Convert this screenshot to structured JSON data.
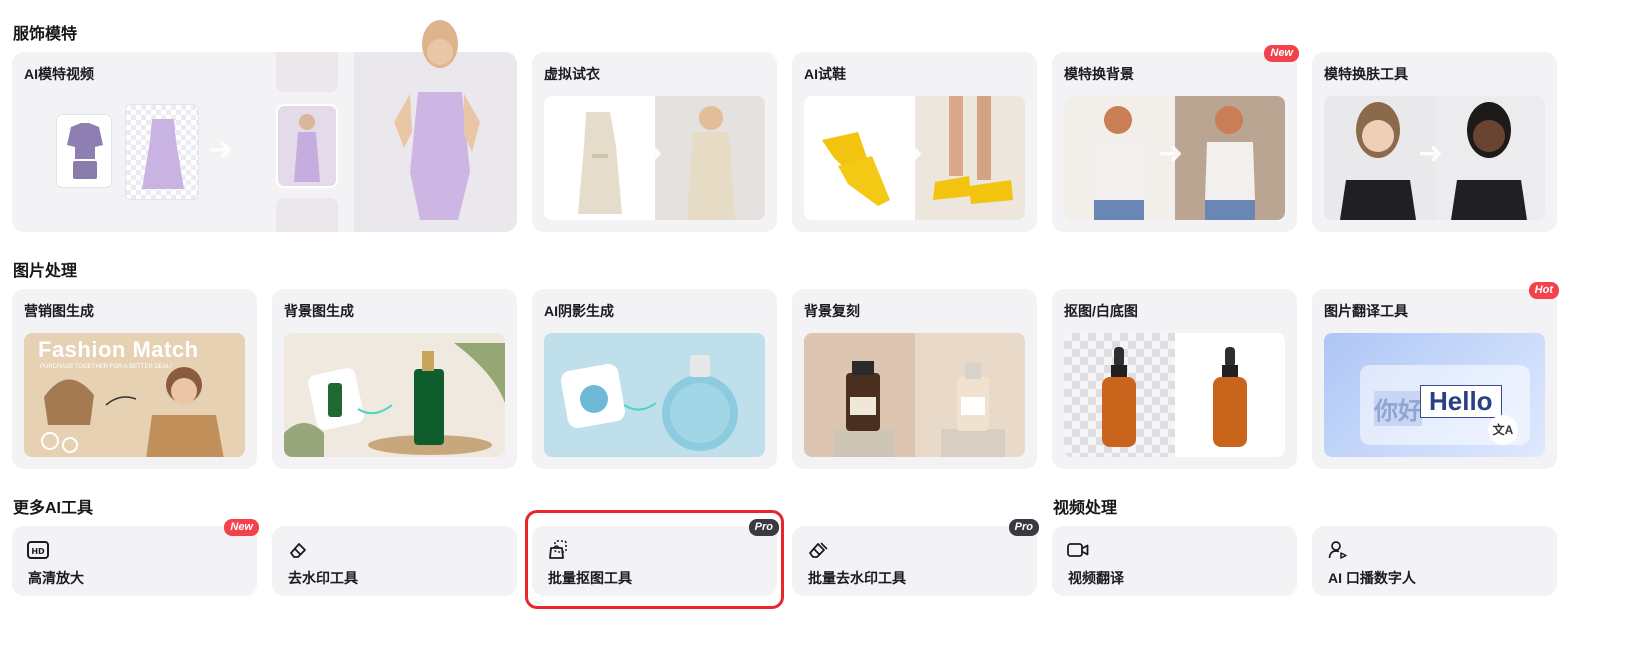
{
  "sections": {
    "fashion": "服饰模特",
    "image": "图片处理",
    "more_ai": "更多AI工具",
    "video": "视频处理"
  },
  "fashion_cards": [
    {
      "label": "AI模特视频"
    },
    {
      "label": "虚拟试衣"
    },
    {
      "label": "AI试鞋"
    },
    {
      "label": "模特换背景",
      "badge": "New"
    },
    {
      "label": "模特换肤工具"
    }
  ],
  "image_cards": [
    {
      "label": "营销图生成",
      "thumb_heading": "Fashion Match",
      "thumb_sub": "PURCHASE TOGETHER FOR A BETTER DEAL!"
    },
    {
      "label": "背景图生成"
    },
    {
      "label": "AI阴影生成"
    },
    {
      "label": "背景复刻"
    },
    {
      "label": "抠图/白底图"
    },
    {
      "label": "图片翻译工具",
      "badge": "Hot",
      "thumb_src": "你好",
      "thumb_dst": "Hello"
    }
  ],
  "tools": [
    {
      "label": "高清放大",
      "badge": "New",
      "icon": "hd-icon"
    },
    {
      "label": "去水印工具",
      "icon": "eraser-icon"
    },
    {
      "label": "批量抠图工具",
      "badge": "Pro",
      "icon": "batch-cutout-icon"
    },
    {
      "label": "批量去水印工具",
      "badge": "Pro",
      "icon": "batch-eraser-icon"
    },
    {
      "label": "视频翻译",
      "icon": "video-camera-icon"
    },
    {
      "label": "AI 口播数字人",
      "icon": "avatar-speaker-icon"
    }
  ],
  "colors": {
    "card_bg": "#f3f3f6",
    "section_highlight": "#d9f58a",
    "badge_red": "#f2424b",
    "badge_dark": "#3a3a40",
    "selection_border": "#e8262b"
  }
}
